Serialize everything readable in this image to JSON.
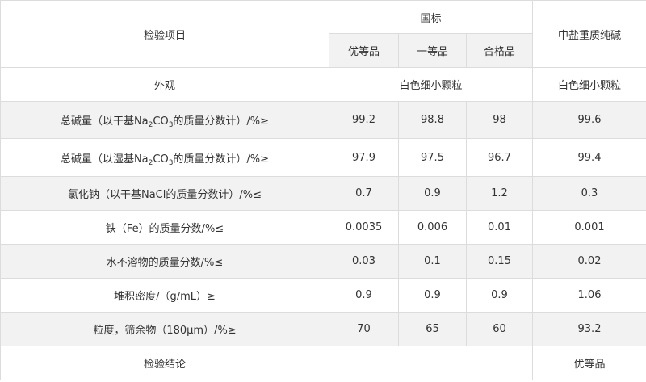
{
  "header": {
    "item": "检验项目",
    "national_standard": "国标",
    "grade_excellent": "优等品",
    "grade_first": "一等品",
    "grade_qualified": "合格品",
    "company_col": "中盐重质纯碱"
  },
  "appearance": {
    "label": "外观",
    "national": "白色细小颗粒",
    "company": "白色细小颗粒"
  },
  "rows": [
    {
      "label_pre": "总碱量（以干基Na",
      "sub1": "2",
      "label_mid": "CO",
      "sub2": "3",
      "label_post": "的质量分数计）/%≥",
      "v1": "99.2",
      "v2": "98.8",
      "v3": "98",
      "v4": "99.6"
    },
    {
      "label_pre": "总碱量（以湿基Na",
      "sub1": "2",
      "label_mid": "CO",
      "sub2": "3",
      "label_post": "的质量分数计）/%≥",
      "v1": "97.9",
      "v2": "97.5",
      "v3": "96.7",
      "v4": "99.4"
    },
    {
      "label": "氯化钠（以干基NaCl的质量分数计）/%≤",
      "v1": "0.7",
      "v2": "0.9",
      "v3": "1.2",
      "v4": "0.3"
    },
    {
      "label": "铁（Fe）的质量分数/%≤",
      "v1": "0.0035",
      "v2": "0.006",
      "v3": "0.01",
      "v4": "0.001"
    },
    {
      "label": "水不溶物的质量分数/%≤",
      "v1": "0.03",
      "v2": "0.1",
      "v3": "0.15",
      "v4": "0.02"
    },
    {
      "label": "堆积密度/（g/mL）≥",
      "v1": "0.9",
      "v2": "0.9",
      "v3": "0.9",
      "v4": "1.06"
    },
    {
      "label": "粒度，筛余物（180μm）/%≥",
      "v1": "70",
      "v2": "65",
      "v3": "60",
      "v4": "93.2"
    }
  ],
  "conclusion": {
    "label": "检验结论",
    "national": "",
    "company": "优等品"
  }
}
